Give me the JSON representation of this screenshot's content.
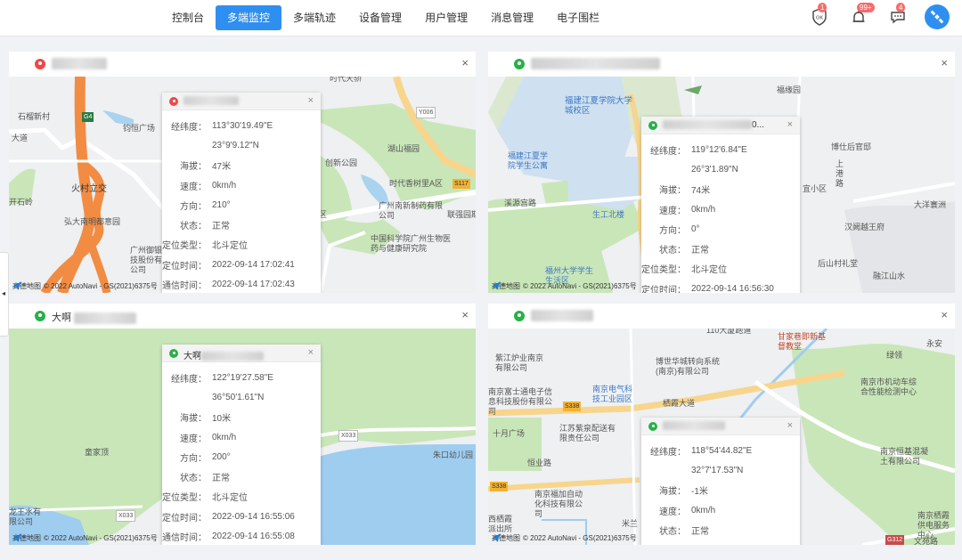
{
  "nav": {
    "items": [
      "控制台",
      "多端监控",
      "多端轨迹",
      "设备管理",
      "用户管理",
      "消息管理",
      "电子围栏"
    ],
    "active_index": 1
  },
  "header_icons": {
    "ok_icon_text": "OK",
    "ok_badge": "1",
    "notice_badge": "99+",
    "message_badge": "4"
  },
  "map_attribution": {
    "brand": "高德地图",
    "copyright": "© 2022 AutoNavi - GS(2021)6375号"
  },
  "field_labels": {
    "coords": "经纬度：",
    "altitude": "海拔：",
    "speed": "速度：",
    "direction": "方向：",
    "status": "状态：",
    "loc_type": "定位类型：",
    "loc_time": "定位时间：",
    "comm_time": "通信时间："
  },
  "panels": [
    {
      "title": "",
      "marker_color": "red",
      "close": "×",
      "popup": {
        "name": "",
        "lng": "113°30'19.49\"E",
        "lat": "23°9'9.12\"N",
        "altitude": "47米",
        "speed": "0km/h",
        "direction": "210°",
        "status": "正常",
        "loc_type": "北斗定位",
        "loc_time": "2022-09-14 17:02:41",
        "comm_time": "2022-09-14 17:02:43"
      },
      "map_labels": [
        "时代天骄",
        "Y006",
        "石榴新村",
        "G4",
        "钧恒广场",
        "大道",
        "湖山福园",
        "创新公园",
        "火村立交",
        "时代香树里A区",
        "S117",
        "开石岭",
        "弘大南明都意园",
        "里B区",
        "广州南新制药有限公司",
        "联强园期",
        "广州御银科技股份有限公司",
        "中国科学院广州生物医药与健康研究院"
      ]
    },
    {
      "title": "",
      "marker_color": "green",
      "close": "×",
      "popup": {
        "name": "0...",
        "lng": "119°12'6.84\"E",
        "lat": "26°3'1.89\"N",
        "altitude": "74米",
        "speed": "0km/h",
        "direction": "0°",
        "status": "正常",
        "loc_type": "北斗定位",
        "loc_time": "2022-09-14 16:56:30"
      },
      "map_labels": [
        "福建江夏学院大学城校区",
        "福缘园",
        "福建江夏学院学生公寓",
        "博仕后官邸",
        "上港路",
        "溪源宫路",
        "生工北楼",
        "宜小区",
        "大洋寰洲",
        "汉阙越王府",
        "福州大学学生生活区",
        "后山村礼堂",
        "融江山水"
      ]
    },
    {
      "title": "大啊",
      "marker_color": "green",
      "close": "×",
      "popup": {
        "name": "大啊",
        "lng": "122°19'27.58\"E",
        "lat": "36°50'1.61\"N",
        "altitude": "10米",
        "speed": "0km/h",
        "direction": "200°",
        "status": "正常",
        "loc_type": "北斗定位",
        "loc_time": "2022-09-14 16:55:06",
        "comm_time": "2022-09-14 16:55:08"
      },
      "map_labels": [
        "X033",
        "童家顶",
        "朱口幼儿园",
        "龙王水有限公司",
        "X033"
      ]
    },
    {
      "title": "",
      "marker_color": "green",
      "close": "×",
      "popup": {
        "name": "",
        "lng": "118°54'44.82\"E",
        "lat": "32°7'17.53\"N",
        "altitude": "-1米",
        "speed": "0km/h",
        "status": "正常"
      },
      "map_labels": [
        "110大厦跑道",
        "甘家巷即新基督教堂",
        "永安",
        "紫江炉业南京有限公司",
        "博世华城转向系统(南京)有限公司",
        "绿领",
        "南京市机动车综合性能检测中心",
        "南京富士通电子信息科技股份有限公司",
        "南京电气科技工业园区",
        "栖霞大道",
        "S338",
        "十月广场",
        "江苏紫泉配送有限责任公司",
        "南京恒基混凝土有限公司",
        "恒业路",
        "S338",
        "南京福加自动化科技有限公司",
        "西栖霞派出所",
        "南京栖霞供电服务中心",
        "G312",
        "文苑路",
        "米兰"
      ]
    }
  ],
  "left_toggle": "◂"
}
